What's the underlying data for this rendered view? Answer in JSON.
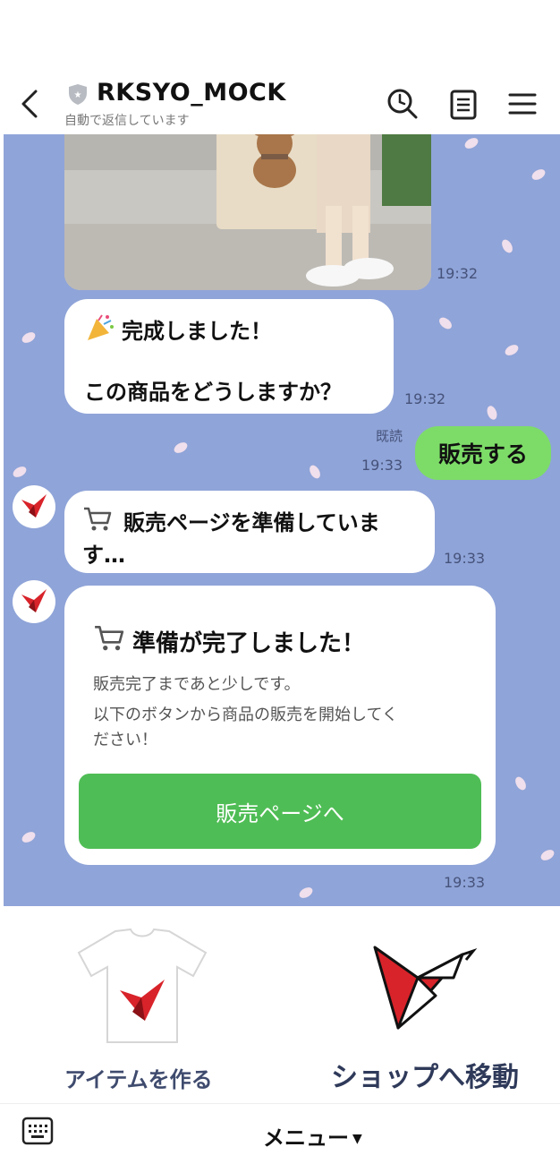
{
  "header": {
    "title": "RKSYO_MOCK",
    "subtitle": "自動で返信しています",
    "icons": [
      "back-icon",
      "shield-icon",
      "search-icon",
      "notes-icon",
      "hamburger-menu-icon"
    ]
  },
  "messages": {
    "photo_time": "19:32",
    "bot1": {
      "line1": "完成しました！",
      "line2": "この商品をどうしますか？",
      "time": "19:32"
    },
    "user1": {
      "text": "販売する",
      "read": "既読",
      "time": "19:33"
    },
    "bot2": {
      "line1": "販売ページを準備していま",
      "line2": "す…",
      "time": "19:33"
    },
    "card": {
      "title": "準備が完了しました！",
      "body1": "販売完了まであと少しです。",
      "body2": "以下のボタンから商品の販売を開始してく",
      "body3": "ださい！",
      "button": "販売ページへ",
      "time": "19:33"
    }
  },
  "richmenu": {
    "left_label": "アイテムを作る",
    "right_label": "ショップへ移動"
  },
  "bottombar": {
    "menu_label": "メニュー",
    "keyboard_icon": "keyboard-icon"
  },
  "colors": {
    "chat_bg": "#8fa4d8",
    "user_bubble": "#7ddc68",
    "cta_button": "#4fbd55",
    "brand_red": "#d8232a"
  }
}
